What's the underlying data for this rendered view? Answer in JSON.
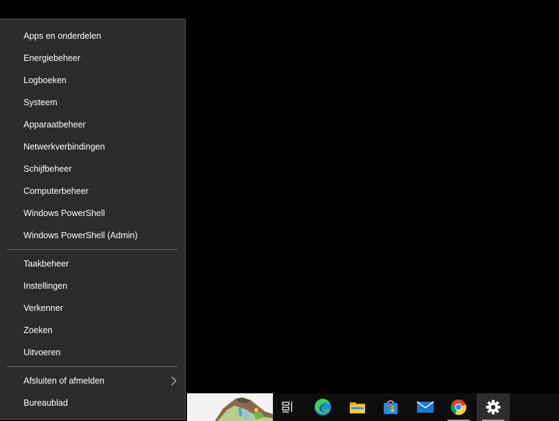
{
  "menu": {
    "groups": [
      {
        "items": [
          {
            "label": "Apps en onderdelen"
          },
          {
            "label": "Energiebeheer"
          },
          {
            "label": "Logboeken"
          },
          {
            "label": "Systeem"
          },
          {
            "label": "Apparaatbeheer"
          },
          {
            "label": "Netwerkverbindingen"
          },
          {
            "label": "Schijfbeheer"
          },
          {
            "label": "Computerbeheer"
          },
          {
            "label": "Windows PowerShell"
          },
          {
            "label": "Windows PowerShell (Admin)"
          }
        ]
      },
      {
        "items": [
          {
            "label": "Taakbeheer"
          },
          {
            "label": "Instellingen"
          },
          {
            "label": "Verkenner"
          },
          {
            "label": "Zoeken"
          },
          {
            "label": "Uitvoeren"
          }
        ]
      },
      {
        "items": [
          {
            "label": "Afsluiten of afmelden",
            "submenu": true,
            "icon": "chevron-right-icon"
          },
          {
            "label": "Bureaublad"
          }
        ]
      }
    ]
  },
  "taskbar": {
    "search_thumbnail": "landscape-thumbnail",
    "apps": [
      {
        "name": "task-view-icon"
      },
      {
        "name": "edge-icon"
      },
      {
        "name": "file-explorer-icon"
      },
      {
        "name": "microsoft-store-icon"
      },
      {
        "name": "mail-icon"
      },
      {
        "name": "chrome-icon"
      },
      {
        "name": "settings-gear-icon",
        "active": true
      }
    ]
  },
  "colors": {
    "menu_background": "#2b2b2b",
    "menu_text": "#ffffff",
    "separator": "#6b6b6b",
    "desktop": "#000000",
    "taskbar": "#0d0d0d"
  }
}
